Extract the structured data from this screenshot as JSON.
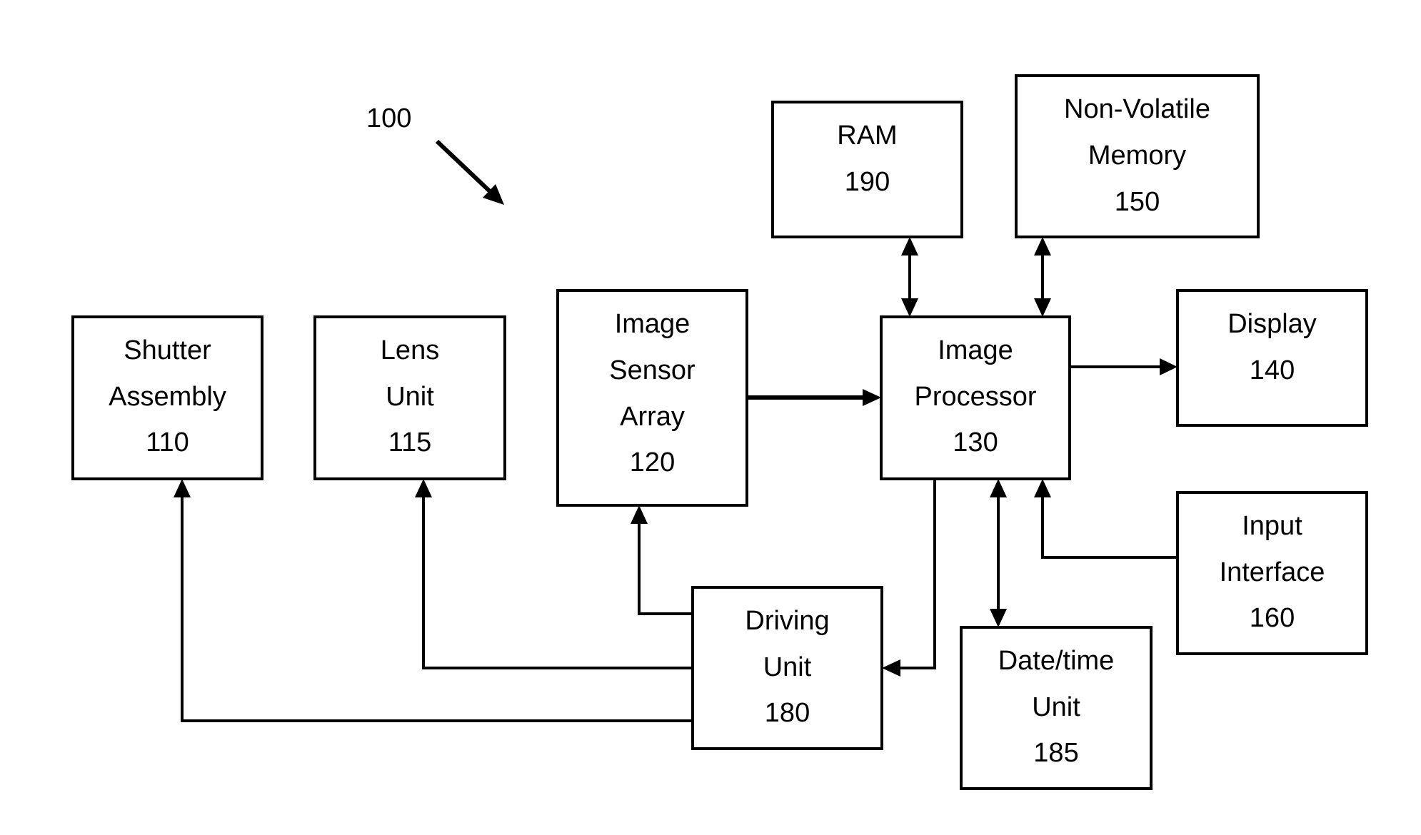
{
  "figure": {
    "reference": "100"
  },
  "blocks": {
    "shutter": {
      "lines": [
        "Shutter",
        "Assembly",
        "110"
      ]
    },
    "lens": {
      "lines": [
        "Lens",
        "Unit",
        "115"
      ]
    },
    "sensor": {
      "lines": [
        "Image",
        "Sensor",
        "Array",
        "120"
      ]
    },
    "ram": {
      "lines": [
        "RAM",
        "190"
      ]
    },
    "nvm": {
      "lines": [
        "Non-Volatile",
        "Memory",
        "150"
      ]
    },
    "processor": {
      "lines": [
        "Image",
        "Processor",
        "130"
      ]
    },
    "display": {
      "lines": [
        "Display",
        "140"
      ]
    },
    "input": {
      "lines": [
        "Input",
        "Interface",
        "160"
      ]
    },
    "driving": {
      "lines": [
        "Driving",
        "Unit",
        "180"
      ]
    },
    "datetime": {
      "lines": [
        "Date/time",
        "Unit",
        "185"
      ]
    }
  },
  "connections": [
    {
      "from": "sensor",
      "to": "processor",
      "type": "one-way"
    },
    {
      "from": "processor",
      "to": "display",
      "type": "one-way"
    },
    {
      "from": "ram",
      "to": "processor",
      "type": "two-way"
    },
    {
      "from": "nvm",
      "to": "processor",
      "type": "two-way"
    },
    {
      "from": "processor",
      "to": "datetime",
      "type": "two-way"
    },
    {
      "from": "input",
      "to": "processor",
      "type": "one-way"
    },
    {
      "from": "processor",
      "to": "driving",
      "type": "one-way"
    },
    {
      "from": "driving",
      "to": "sensor",
      "type": "one-way"
    },
    {
      "from": "driving",
      "to": "lens",
      "type": "one-way"
    },
    {
      "from": "driving",
      "to": "shutter",
      "type": "one-way"
    }
  ]
}
